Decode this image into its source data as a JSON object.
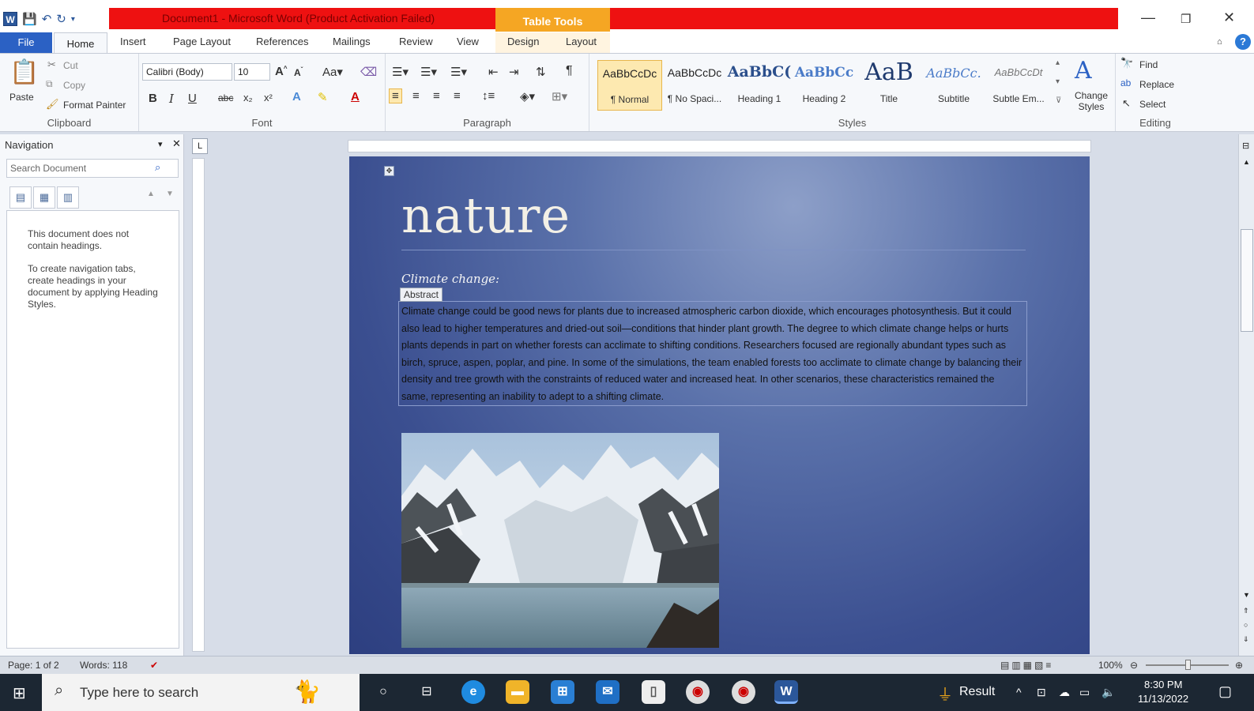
{
  "window": {
    "title": "Document1 - Microsoft Word (Product Activation Failed)",
    "context_tab_group": "Table Tools",
    "controls": {
      "minimize": "—",
      "restore": "❐",
      "close": "✕"
    }
  },
  "tabs": {
    "file": "File",
    "home": "Home",
    "insert": "Insert",
    "page_layout": "Page Layout",
    "references": "References",
    "mailings": "Mailings",
    "review": "Review",
    "view": "View",
    "design": "Design",
    "layout": "Layout"
  },
  "ribbon": {
    "clipboard": {
      "label": "Clipboard",
      "paste": "Paste",
      "cut": "Cut",
      "copy": "Copy",
      "format_painter": "Format Painter"
    },
    "font": {
      "label": "Font",
      "font_name": "Calibri (Body)",
      "font_size": "10"
    },
    "paragraph": {
      "label": "Paragraph"
    },
    "styles": {
      "label": "Styles",
      "items": [
        {
          "sample": "AaBbCcDc",
          "name": "¶ Normal"
        },
        {
          "sample": "AaBbCcDc",
          "name": "¶ No Spaci..."
        },
        {
          "sample": "AaBbC(",
          "name": "Heading 1"
        },
        {
          "sample": "AaBbCc",
          "name": "Heading 2"
        },
        {
          "sample": "AaB",
          "name": "Title"
        },
        {
          "sample": "AaBbCc.",
          "name": "Subtitle"
        },
        {
          "sample": "AaBbCcDt",
          "name": "Subtle Em..."
        }
      ],
      "change_styles": "Change Styles"
    },
    "editing": {
      "label": "Editing",
      "find": "Find",
      "replace": "Replace",
      "select": "Select"
    }
  },
  "navigation": {
    "title": "Navigation",
    "search_placeholder": "Search Document",
    "message1": "This document does not contain headings.",
    "message2": "To create navigation tabs, create headings in your document by applying Heading Styles."
  },
  "document": {
    "title": "nature",
    "subtitle": "Climate change:",
    "abstract_label": "Abstract",
    "abstract_text": "Climate change could be good news for plants due to increased atmospheric carbon dioxide, which encourages photosynthesis. But it could also lead to higher temperatures and dried-out soil—conditions that hinder plant growth. The degree to which climate change helps or hurts plants depends in part on whether forests can acclimate to shifting conditions. Researchers focused are regionally abundant types such as birch, spruce, aspen, poplar, and pine. In some of the simulations, the team enabled forests too acclimate to climate change by balancing their density and tree growth with the constraints of reduced water and increased heat. In other scenarios, these characteristics remained the same, representing an inability to adept to a shifting climate."
  },
  "status": {
    "page": "Page: 1 of 2",
    "words": "Words: 118",
    "zoom": "100%"
  },
  "taskbar": {
    "search_placeholder": "Type here to search",
    "result_label": "Result",
    "time": "8:30 PM",
    "date": "11/13/2022"
  },
  "colors": {
    "title_bar_red": "#ee1111",
    "table_tools_orange": "#f5a623",
    "file_tab_blue": "#2b61c4",
    "page_background": "#3b4f90"
  }
}
